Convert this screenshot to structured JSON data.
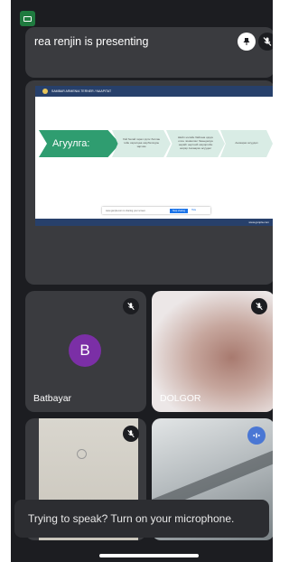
{
  "presentation": {
    "title": "rea renjin is presenting",
    "slide": {
      "header_text": "SAMBAR ARMENIA TERNER / NAAPITAT",
      "main_label": "Агуулга:",
      "chevron_1": "Хэй белай гараз тдлэг батлан тийн харилцаа ширбэлэгдэн зарчим",
      "chevron_2": "Шейл нэлэйн байгана цэрүн олон чинвалинг бааыдалда нөрайг нөртний ширяргийн ширяр Анхаарах асуудал",
      "chevron_3": "Анхаарах асуудал",
      "share_text": "www.gsnpla.com is sharing your screen.",
      "stop_label": "Stop sharing",
      "hide_label": "Hide",
      "footer_url": "www.gsnpla.com"
    }
  },
  "participants": [
    {
      "name": "Batbayar",
      "avatar_letter": "B",
      "avatar_color": "#7b2fa6",
      "muted": true
    },
    {
      "name": "DOLGOR",
      "muted": true
    },
    {
      "name": "",
      "muted": true
    },
    {
      "name": "",
      "speaking": true
    }
  ],
  "toast": {
    "text": "Trying to speak? Turn on your microphone."
  },
  "colors": {
    "background": "#1c1d21",
    "card": "#3a3b3f",
    "slide_header": "#27406b",
    "slide_accent": "#2f9d70",
    "speaking": "#4a77d4"
  },
  "icons": {
    "status": "screen-share-icon",
    "pin": "pin-icon",
    "mute": "mic-off-icon",
    "fullscreen": "fullscreen-icon",
    "speaking": "audio-wave-icon"
  }
}
